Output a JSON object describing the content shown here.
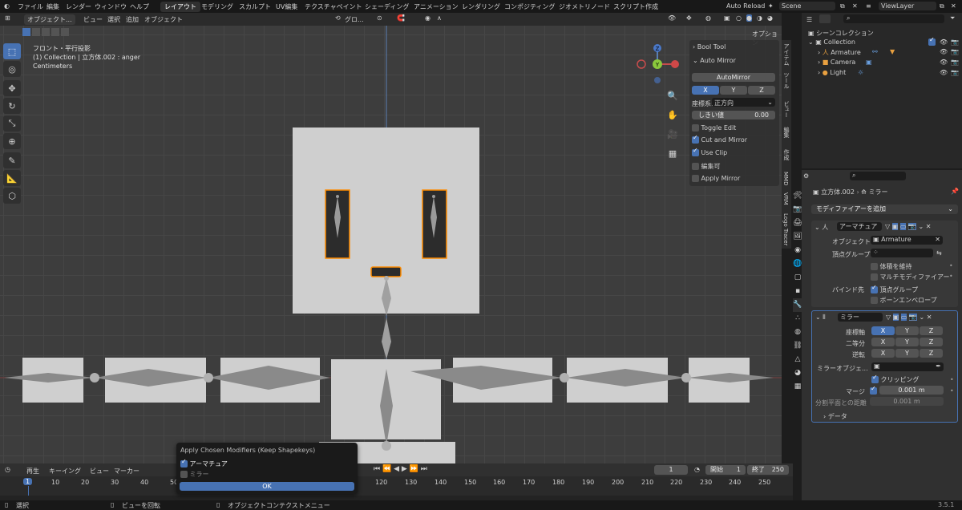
{
  "menubar": {
    "menus": [
      "ファイル",
      "編集",
      "レンダー",
      "ウィンドウ",
      "ヘルプ"
    ],
    "workspaces": [
      "レイアウト",
      "モデリング",
      "スカルプト",
      "UV編集",
      "テクスチャペイント",
      "シェーディング",
      "アニメーション",
      "レンダリング",
      "コンポジティング",
      "ジオメトリノード",
      "スクリプト作成"
    ],
    "active_workspace": "レイアウト",
    "auto_reload": "Auto Reload",
    "scene": "Scene",
    "view_layer": "ViewLayer"
  },
  "viewport_header": {
    "mode": "オブジェクト...",
    "menus": [
      "ビュー",
      "選択",
      "追加",
      "オブジェクト"
    ],
    "transform": "グロ...",
    "options": "オプション"
  },
  "viewport_overlay": {
    "view_name": "フロント・平行投影",
    "collection_info": "(1) Collection | 立方体.002 : anger",
    "units": "Centimeters"
  },
  "gizmo": {
    "x": "X",
    "y": "Y",
    "z": "Z"
  },
  "npanel": {
    "section_bool": "Bool Tool",
    "section_mirror": "Auto Mirror",
    "automirror_button": "AutoMirror",
    "axes": [
      "X",
      "Y",
      "Z"
    ],
    "active_axis": "X",
    "orientation_label": "座標系:",
    "orientation_value": "正方向",
    "threshold_label": "しきい値",
    "threshold_value": "0.00",
    "toggles": [
      {
        "label": "Toggle Edit",
        "checked": false
      },
      {
        "label": "Cut and Mirror",
        "checked": true
      },
      {
        "label": "Use Clip",
        "checked": true
      },
      {
        "label": "編集可",
        "checked": false
      },
      {
        "label": "Apply Mirror",
        "checked": false
      }
    ]
  },
  "side_tabs": [
    "アイテム",
    "ツール",
    "ビュー",
    "編集",
    "作成",
    "MMD",
    "VRM",
    "Logo Tracer"
  ],
  "outliner": {
    "root": "シーンコレクション",
    "collection": "Collection",
    "items": [
      "Armature",
      "Camera",
      "Light"
    ]
  },
  "properties": {
    "breadcrumb_object": "立方体.002",
    "breadcrumb_modifier": "ミラー",
    "add_modifier": "モディファイアーを追加",
    "armature_mod": {
      "name": "アーマチュア",
      "object_label": "オブジェクト",
      "object_value": "Armature",
      "vgroup_label": "頂点グループ",
      "preserve_volume": "体積を維持",
      "multi_modifier": "マルチモディファイアー",
      "bind_label": "バインド先",
      "bind_vgroups": "頂点グループ",
      "bind_envelopes": "ボーンエンベロープ"
    },
    "mirror_mod": {
      "name": "ミラー",
      "axis_label": "座標軸",
      "bisect_label": "二等分",
      "flip_label": "逆転",
      "axes": [
        "X",
        "Y",
        "Z"
      ],
      "mirror_object_label": "ミラーオブジェ...",
      "clipping_label": "クリッピング",
      "merge_label": "マージ",
      "merge_value": "0.001 m",
      "bisect_dist_label": "分割平面との距離",
      "bisect_dist_value": "0.001 m",
      "data_label": "データ"
    }
  },
  "popup": {
    "title": "Apply Chosen Modifiers (Keep Shapekeys)",
    "items": [
      {
        "label": "アーマチュア",
        "checked": true
      },
      {
        "label": "ミラー",
        "checked": false
      }
    ],
    "ok": "OK"
  },
  "timeline": {
    "menus": [
      "再生",
      "キーイング",
      "ビュー",
      "マーカー"
    ],
    "current_frame": "1",
    "start_label": "開始",
    "start_value": "1",
    "end_label": "終了",
    "end_value": "250",
    "ticks": [
      "1",
      "10",
      "20",
      "30",
      "40",
      "50",
      "120",
      "130",
      "140",
      "150",
      "160",
      "170",
      "180",
      "190",
      "200",
      "210",
      "220",
      "230",
      "240",
      "250"
    ]
  },
  "statusbar": {
    "select": "選択",
    "rotate": "ビューを回転",
    "context": "オブジェクトコンテクストメニュー",
    "version": "3.5.1"
  },
  "colors": {
    "accent": "#4772b3",
    "selection_outline": "#ff8c00",
    "header_bg": "#2b2b2b",
    "viewport_bg": "#3d3d3d"
  }
}
